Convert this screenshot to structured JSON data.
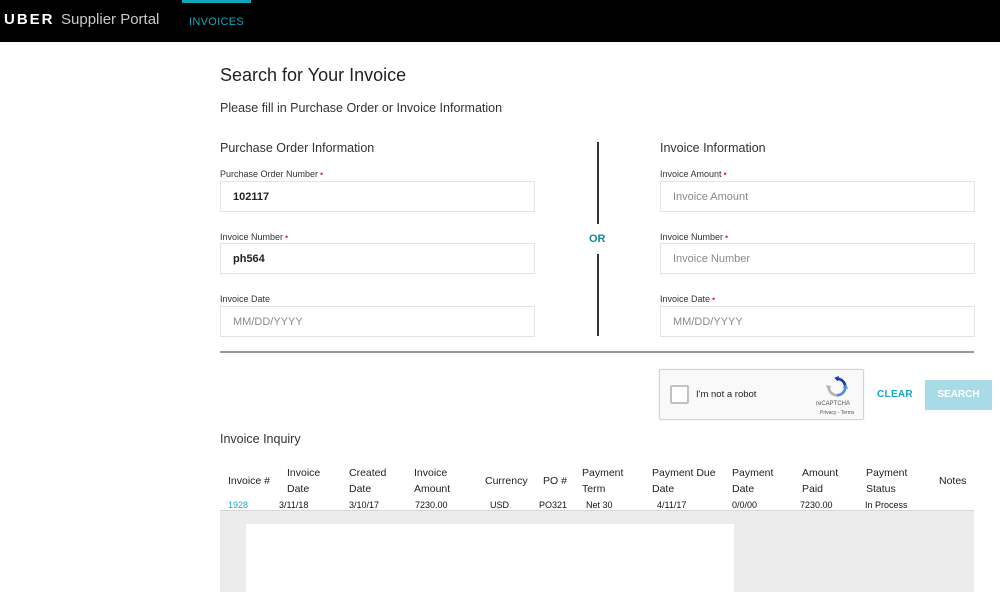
{
  "header": {
    "brand": "UBER",
    "brand_sub": "Supplier Portal",
    "nav_tab": "INVOICES"
  },
  "page": {
    "title": "Search for Your Invoice",
    "subtitle": "Please fill in Purchase Order or Invoice Information",
    "or_label": "OR"
  },
  "po_section": {
    "title": "Purchase Order Information",
    "po_number_label": "Purchase Order Number",
    "po_number_value": "102117",
    "invoice_number_label": "Invoice Number",
    "invoice_number_value": "ph564",
    "invoice_date_label": "Invoice Date",
    "invoice_date_placeholder": "MM/DD/YYYY"
  },
  "invoice_section": {
    "title": "Invoice Information",
    "amount_label": "Invoice Amount",
    "amount_placeholder": "Invoice Amount",
    "invoice_number_label": "Invoice Number",
    "invoice_number_placeholder": "Invoice Number",
    "invoice_date_label": "Invoice Date",
    "invoice_date_placeholder": "MM/DD/YYYY"
  },
  "required_marker": "•",
  "captcha": {
    "label": "I'm not a robot",
    "brand": "reCAPTCHA",
    "terms": "Privacy - Terms"
  },
  "actions": {
    "clear": "CLEAR",
    "search": "SEARCH"
  },
  "inquiry": {
    "title": "Invoice Inquiry",
    "columns": [
      [
        "Invoice #"
      ],
      [
        "Invoice",
        "Date"
      ],
      [
        "Created",
        "Date"
      ],
      [
        "Invoice",
        "Amount"
      ],
      [
        "Currency"
      ],
      [
        "PO #"
      ],
      [
        "Payment",
        "Term"
      ],
      [
        "Payment Due",
        "Date"
      ],
      [
        "Payment",
        "Date"
      ],
      [
        "Amount",
        "Paid"
      ],
      [
        "Payment",
        "Status"
      ],
      [
        "Notes"
      ]
    ],
    "rows": [
      [
        "1928",
        "3/11/18",
        "3/10/17",
        "7230.00",
        "USD",
        "PO321",
        "Net 30",
        "4/11/17",
        "0/0/00",
        "7230.00",
        "In Process",
        ""
      ]
    ]
  },
  "colors": {
    "accent": "#13a6b8",
    "search_disabled": "#a8dbe7",
    "required": "#e22222"
  }
}
